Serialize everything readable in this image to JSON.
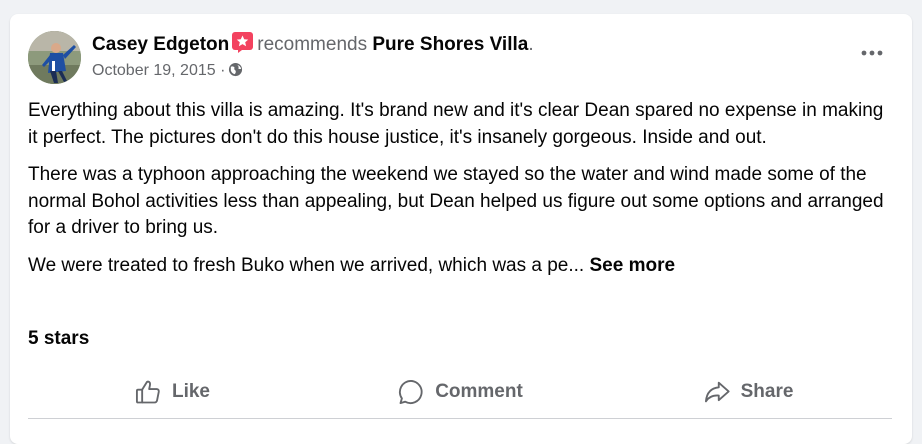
{
  "post": {
    "author": "Casey Edgeton",
    "recommends_text": "recommends",
    "page_name": "Pure Shores Villa",
    "period": ".",
    "date": "October 19, 2015",
    "separator": "·",
    "audience_icon": "globe-icon",
    "recommend_badge_icon": "recommend-star-icon",
    "more_icon": "more-horizontal-icon",
    "paragraphs": [
      "Everything about this villa is amazing. It's brand new and it's clear Dean spared no expense in making it perfect. The pictures don't do this house justice, it's insanely gorgeous. Inside and out.",
      "There was a typhoon approaching the weekend we stayed so the water and wind made some of the normal Bohol activities less than appealing, but Dean helped us figure out some options and arranged for a driver to bring us.",
      "We were treated to fresh Buko when we arrived, which was a pe..."
    ],
    "see_more": "See more",
    "rating": "5 stars"
  },
  "actions": {
    "like": "Like",
    "comment": "Comment",
    "share": "Share"
  },
  "colors": {
    "background": "#f0f2f5",
    "card": "#ffffff",
    "text": "#050505",
    "secondary": "#65676b",
    "badge": "#f3425f"
  }
}
